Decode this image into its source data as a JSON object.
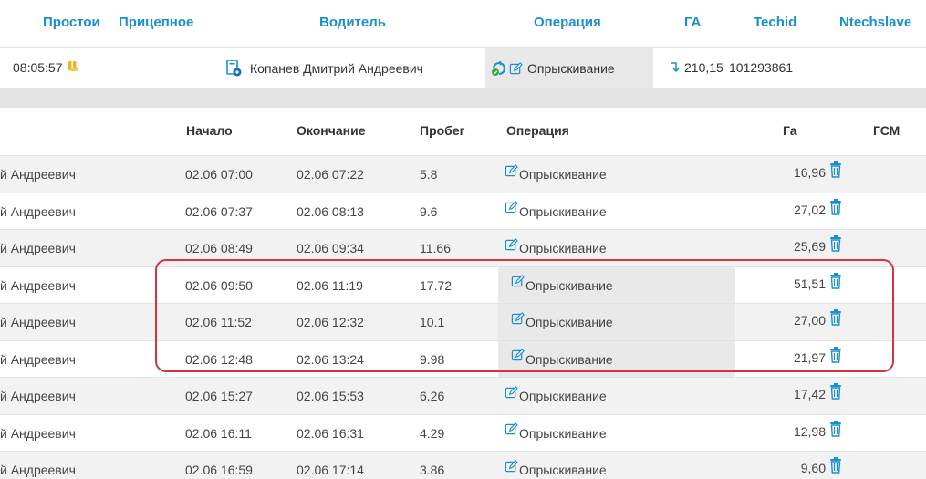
{
  "header": {
    "prostoi": "Простои",
    "pritsepnoe": "Прицепное",
    "voditel": "Водитель",
    "operatsiya": "Операция",
    "ga": "ГА",
    "techid": "Techid",
    "ntechslave": "Ntechslave"
  },
  "top_row": {
    "time": "08:05:57",
    "driver": "Копанев Дмитрий Андреевич",
    "operation": "Опрыскивание",
    "ga": "210,15",
    "techid": "101293861"
  },
  "table": {
    "columns": {
      "start": "Начало",
      "end": "Окончание",
      "mileage": "Пробег",
      "operation": "Операция",
      "ga": "Га",
      "gsm": "ГСМ"
    },
    "rows": [
      {
        "driver": "й Андреевич",
        "start": "02.06 07:00",
        "end": "02.06 07:22",
        "mileage": "5.8",
        "operation": "Опрыскивание",
        "ga": "16,96"
      },
      {
        "driver": "й Андреевич",
        "start": "02.06 07:37",
        "end": "02.06 08:13",
        "mileage": "9.6",
        "operation": "Опрыскивание",
        "ga": "27,02"
      },
      {
        "driver": "й Андреевич",
        "start": "02.06 08:49",
        "end": "02.06 09:34",
        "mileage": "11.66",
        "operation": "Опрыскивание",
        "ga": "25,69"
      },
      {
        "driver": "й Андреевич",
        "start": "02.06 09:50",
        "end": "02.06 11:19",
        "mileage": "17.72",
        "operation": "Опрыскивание",
        "ga": "51,51"
      },
      {
        "driver": "й Андреевич",
        "start": "02.06 11:52",
        "end": "02.06 12:32",
        "mileage": "10.1",
        "operation": "Опрыскивание",
        "ga": "27,00"
      },
      {
        "driver": "й Андреевич",
        "start": "02.06 12:48",
        "end": "02.06 13:24",
        "mileage": "9.98",
        "operation": "Опрыскивание",
        "ga": "21,97"
      },
      {
        "driver": "й Андреевич",
        "start": "02.06 15:27",
        "end": "02.06 15:53",
        "mileage": "6.26",
        "operation": "Опрыскивание",
        "ga": "17,42"
      },
      {
        "driver": "й Андреевич",
        "start": "02.06 16:11",
        "end": "02.06 16:31",
        "mileage": "4.29",
        "operation": "Опрыскивание",
        "ga": "12,98"
      },
      {
        "driver": "й Андреевич",
        "start": "02.06 16:59",
        "end": "02.06 17:14",
        "mileage": "3.86",
        "operation": "Опрыскивание",
        "ga": "9,60"
      }
    ]
  },
  "colors": {
    "header_text": "#1a8fd0",
    "icon_blue": "#1a8fd0",
    "highlight_frame": "#d8323c",
    "zebra": "#f2f2f2"
  },
  "icons": {
    "yellow_marker": "yellow-marker-icon",
    "driver": "driver-icon",
    "operation_status": "operation-status-icon",
    "edit": "edit-icon",
    "arrow": "arrow-return-icon",
    "trash": "trash-icon"
  }
}
